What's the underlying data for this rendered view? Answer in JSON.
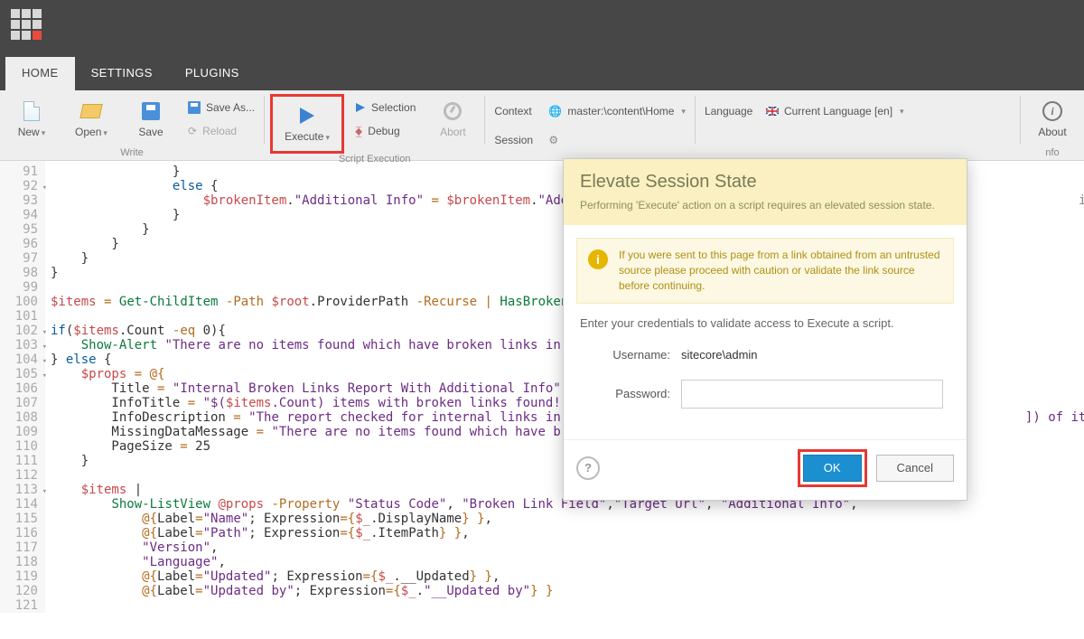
{
  "tabs": {
    "home": "HOME",
    "settings": "SETTINGS",
    "plugins": "PLUGINS"
  },
  "ribbon": {
    "new": "New",
    "open": "Open",
    "save": "Save",
    "saveAs": "Save As...",
    "reload": "Reload",
    "write": "Write",
    "execute": "Execute",
    "selection": "Selection",
    "debug": "Debug",
    "abort": "Abort",
    "scriptExec": "Script Execution",
    "context": "Context",
    "session": "Session",
    "contextVal": "master:\\content\\Home",
    "language": "Language",
    "langVal": "Current Language [en]",
    "info": "Info",
    "aboutTruncated": "About",
    "nfo": "nfo"
  },
  "editor": {
    "start": 91,
    "lines": [
      {
        "n": 91,
        "html": "                }"
      },
      {
        "n": 92,
        "html": "                <span class=c-kw>else</span> {",
        "fold": true
      },
      {
        "n": 93,
        "html": "                    <span class=c-var>$brokenItem</span>.<span class=c-str>\"Additional Info\"</span> <span class=c-op>=</span> <span class=c-var>$brokenItem</span>.<span class=c-str>\"Additiona</span>                                                             <span class=c-id>ionalInfo</span>"
      },
      {
        "n": 94,
        "html": "                }"
      },
      {
        "n": 95,
        "html": "            }"
      },
      {
        "n": 96,
        "html": "        }"
      },
      {
        "n": 97,
        "html": "    }"
      },
      {
        "n": 98,
        "html": "}"
      },
      {
        "n": 99,
        "html": ""
      },
      {
        "n": 100,
        "html": "<span class=c-var>$items</span> <span class=c-op>=</span> <span class=c-cmd>Get-ChildItem</span> <span class=c-op>-Path</span> <span class=c-var>$root</span>.ProviderPath <span class=c-op>-Recurse</span> <span class=c-op>|</span> <span class=c-cmd>HasBrokenLink</span>"
      },
      {
        "n": 101,
        "html": ""
      },
      {
        "n": 102,
        "html": "<span class=c-kw>if</span>(<span class=c-var>$items</span>.Count <span class=c-op>-eq</span> 0){",
        "fold": true
      },
      {
        "n": 103,
        "html": "    <span class=c-cmd>Show-Alert</span> <span class=c-str>\"There are no items found which have broken links in the cu</span>",
        "fold": true
      },
      {
        "n": 104,
        "html": "} <span class=c-kw>else</span> {",
        "fold": true
      },
      {
        "n": 105,
        "html": "    <span class=c-var>$props</span> <span class=c-op>=</span> <span class=c-op>@{</span>",
        "fold": true
      },
      {
        "n": 106,
        "html": "        Title <span class=c-op>=</span> <span class=c-str>\"Internal Broken Links Report With Additional Info\"</span>"
      },
      {
        "n": 107,
        "html": "        InfoTitle <span class=c-op>=</span> <span class=c-str>\"$(</span><span class=c-var>$items</span><span class=c-str>.Count) items with broken links found!\"</span>"
      },
      {
        "n": 108,
        "html": "        InfoDescription <span class=c-op>=</span> <span class=c-str>\"The report checked for internal links in $(@('a</span>                                                      <span class=c-str>]) of items.\"</span>"
      },
      {
        "n": 109,
        "html": "        MissingDataMessage <span class=c-op>=</span> <span class=c-str>\"There are no items found which have broken l</span>"
      },
      {
        "n": 110,
        "html": "        PageSize <span class=c-op>=</span> 25"
      },
      {
        "n": 111,
        "html": "    }"
      },
      {
        "n": 112,
        "html": ""
      },
      {
        "n": 113,
        "html": "    <span class=c-var>$items</span> |",
        "fold": true
      },
      {
        "n": 114,
        "html": "        <span class=c-cmd>Show-ListView</span> <span class=c-var>@props</span> <span class=c-op>-Property</span> <span class=c-str>\"Status Code\"</span>, <span class=c-str>\"Broken Link Field\"</span>,<span class=c-str>\"Target Url\"</span>, <span class=c-str>\"Additional Info\"</span>,"
      },
      {
        "n": 115,
        "html": "            <span class=c-op>@{</span>Label<span class=c-op>=</span><span class=c-str>\"Name\"</span>; Expression<span class=c-op>={</span><span class=c-var>$_</span>.DisplayName<span class=c-op>}</span> <span class=c-op>}</span>,"
      },
      {
        "n": 116,
        "html": "            <span class=c-op>@{</span>Label<span class=c-op>=</span><span class=c-str>\"Path\"</span>; Expression<span class=c-op>={</span><span class=c-var>$_</span>.ItemPath<span class=c-op>}</span> <span class=c-op>}</span>,"
      },
      {
        "n": 117,
        "html": "            <span class=c-str>\"Version\"</span>,"
      },
      {
        "n": 118,
        "html": "            <span class=c-str>\"Language\"</span>,"
      },
      {
        "n": 119,
        "html": "            <span class=c-op>@{</span>Label<span class=c-op>=</span><span class=c-str>\"Updated\"</span>; Expression<span class=c-op>={</span><span class=c-var>$_</span>.__Updated<span class=c-op>}</span> <span class=c-op>}</span>,"
      },
      {
        "n": 120,
        "html": "            <span class=c-op>@{</span>Label<span class=c-op>=</span><span class=c-str>\"Updated by\"</span>; Expression<span class=c-op>={</span><span class=c-var>$_</span>.<span class=c-str>\"__Updated by\"</span><span class=c-op>}</span> <span class=c-op>}</span>"
      },
      {
        "n": 121,
        "html": ""
      }
    ]
  },
  "dialog": {
    "title": "Elevate Session State",
    "sub": "Performing 'Execute' action on a script requires an elevated session state.",
    "warn": "If you were sent to this page from a link obtained from an untrusted source please proceed with caution or validate the link source before continuing.",
    "prompt": "Enter your credentials to validate access to Execute a script.",
    "userLabel": "Username:",
    "userVal": "sitecore\\admin",
    "passLabel": "Password:",
    "ok": "OK",
    "cancel": "Cancel"
  }
}
